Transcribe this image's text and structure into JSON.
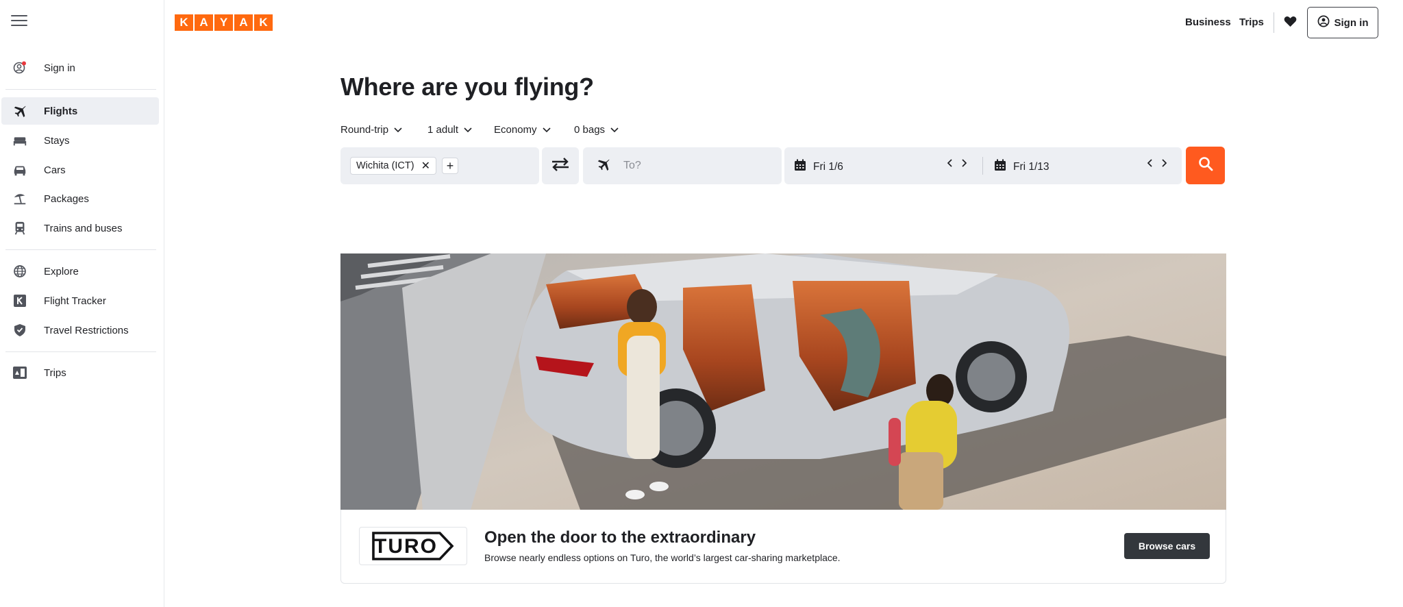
{
  "brand": {
    "logo_letters": [
      "K",
      "A",
      "Y",
      "A",
      "K"
    ],
    "accent": "#ff690f",
    "search_color": "#ff5a1f"
  },
  "header": {
    "business": "Business",
    "trips": "Trips",
    "signin": "Sign in"
  },
  "sidebar": {
    "signin": "Sign in",
    "items": [
      {
        "label": "Flights",
        "icon": "plane-icon"
      },
      {
        "label": "Stays",
        "icon": "bed-icon"
      },
      {
        "label": "Cars",
        "icon": "car-icon"
      },
      {
        "label": "Packages",
        "icon": "beach-umbrella-icon"
      },
      {
        "label": "Trains and buses",
        "icon": "train-icon"
      },
      {
        "label": "Explore",
        "icon": "globe-icon"
      },
      {
        "label": "Flight Tracker",
        "icon": "flight-tracker-icon"
      },
      {
        "label": "Travel Restrictions",
        "icon": "shield-icon"
      },
      {
        "label": "Trips",
        "icon": "trips-icon"
      }
    ]
  },
  "search": {
    "headline": "Where are you flying?",
    "trip_type": "Round-trip",
    "travelers": "1 adult",
    "cabin": "Economy",
    "bags": "0 bags",
    "origin": "Wichita (ICT)",
    "destination_placeholder": "To?",
    "depart_date": "Fri 1/6",
    "return_date": "Fri 1/13"
  },
  "promo": {
    "partner": "TURO",
    "title": "Open the door to the extraordinary",
    "subtitle": "Browse nearly endless options on Turo, the world’s largest car-sharing marketplace.",
    "button": "Browse cars"
  }
}
